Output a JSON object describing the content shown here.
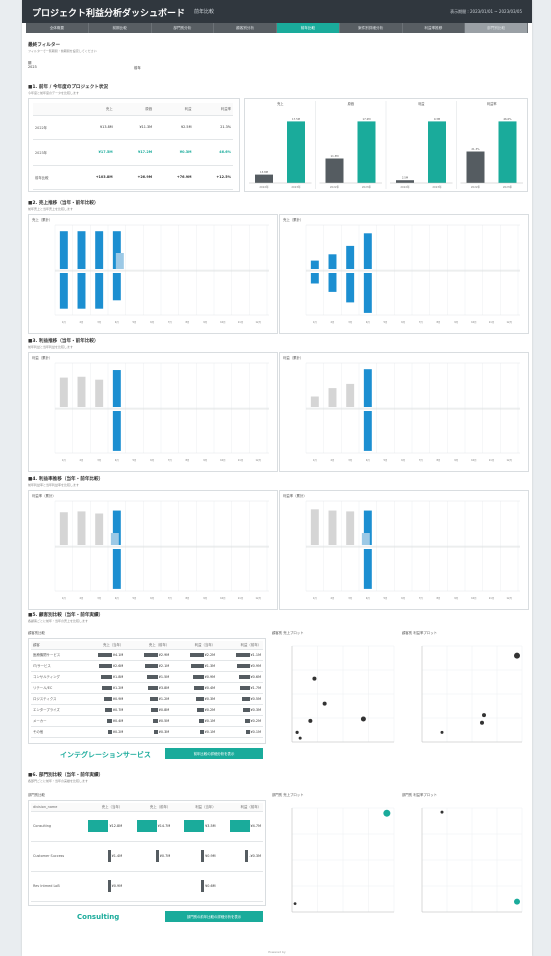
{
  "header": {
    "title": "プロジェクト利益分析ダッシュボード",
    "subtitle": "前年比較",
    "period": "表示期間 : 2023/01/01 ~ 2023/03/05"
  },
  "tabs": [
    "全体概要",
    "前期比較",
    "部門別分析",
    "顧客別分析",
    "前年比較",
    "案件別詳細分析",
    "利益率推移",
    "部門別比較"
  ],
  "active_tab": 4,
  "filter": {
    "title": "最終フィルター",
    "note": "フィルターで一覧期間・前期間を設定してください",
    "a_label": "期",
    "a_value": "2023",
    "b_label": "前年"
  },
  "sec1": {
    "title": "■1. 前年 / 今年度のプロジェクト状況",
    "note": "今年度と前年度のデータを比較します",
    "table": {
      "headers": [
        "",
        "売上",
        "原価",
        "利益",
        "利益率"
      ],
      "rows": [
        [
          "2022年",
          "¥13.8M",
          "¥11.3M",
          "¥2.5M",
          "21.3%"
        ],
        [
          "2023年",
          "¥17.5M",
          "¥17.2M",
          "¥0.3M",
          "46.6%"
        ],
        [
          "前年比較",
          "+103.8M",
          "+26.9M",
          "+76.9M",
          "+12.5%"
        ]
      ]
    },
    "mini_titles": [
      "売上",
      "原価",
      "利益",
      "利益率"
    ],
    "mini_values": [
      [
        "13.8M",
        "17.5M"
      ],
      [
        "11.3M",
        "17.2M"
      ],
      [
        "2.5M",
        "0.3M"
      ],
      [
        "21.3%",
        "46.6%"
      ]
    ],
    "mini_xlabels": [
      "2022年",
      "2023年"
    ]
  },
  "sec2": {
    "title": "■2. 売上推移（当年・前年比較）",
    "note": "前年売上と当年売上を比較します",
    "left_title": "売上（累計）",
    "right_title": "売上（累計）"
  },
  "sec3": {
    "title": "■3. 利益推移（当年・前年比較）",
    "note": "前年利益と当年利益を比較します",
    "left_title": "利益（累計）",
    "right_title": "利益（累計）"
  },
  "sec4": {
    "title": "■4. 利益率推移（当年・前年比較）",
    "note": "前年利益率と当年利益率を比較します",
    "left_title": "利益率（累計）",
    "right_title": "利益率（累計）"
  },
  "sec5": {
    "title": "■5. 顧客別比較（当年・前年実績）",
    "note": "各顧客ごとに前年・当年の売上を比較します",
    "table_title": "顧客別比較",
    "headers": [
      "顧客",
      "売上（当年）",
      "売上（前年）",
      "利益（当年）",
      "利益（前年）"
    ],
    "rows": [
      [
        "医療機関サービス",
        "¥4.1M",
        "¥2.9M",
        "¥2.2M",
        "¥1.1M"
      ],
      [
        "IT/サービス",
        "¥2.6M",
        "¥2.1M",
        "¥1.3M",
        "¥0.9M"
      ],
      [
        "コンサルティング",
        "¥1.8M",
        "¥1.5M",
        "¥0.9M",
        "¥0.6M"
      ],
      [
        "リテール/EC",
        "¥1.2M",
        "¥3.8M",
        "¥0.4M",
        "¥1.7M"
      ],
      [
        "ロジスティクス",
        "¥0.9M",
        "¥1.2M",
        "¥0.3M",
        "¥0.5M"
      ],
      [
        "エンタープライズ",
        "¥0.7M",
        "¥0.8M",
        "¥0.2M",
        "¥0.3M"
      ],
      [
        "メーカー",
        "¥0.4M",
        "¥0.5M",
        "¥0.1M",
        "¥0.2M"
      ],
      [
        "その他",
        "¥0.2M",
        "¥0.3M",
        "¥0.1M",
        "¥0.1M"
      ]
    ],
    "selected": "インテグレーションサービス",
    "button": "前年比較の詳細分析を表示",
    "scatter1_title": "顧客別 売上プロット",
    "scatter2_title": "顧客別 利益率プロット"
  },
  "sec6": {
    "title": "■6. 部門別比較（当年・前年実績）",
    "note": "各部門ごとに前年・当年の実績を比較します",
    "table_title": "部門別比較",
    "headers": [
      "division_name",
      "売上（当年）",
      "売上（前年）",
      "利益（当年）",
      "利益（前年）"
    ],
    "rows": [
      [
        "Consulting",
        "¥12.8M",
        "¥14.7M",
        "¥3.5M",
        "¥4.7M"
      ],
      [
        "Customer Success",
        "¥1.4M",
        "¥0.7M",
        "¥0.9M",
        "-¥0.3M"
      ],
      [
        "Rev Intmed LoB",
        "¥0.9M",
        "",
        "¥0.6M",
        ""
      ]
    ],
    "selected": "Consulting",
    "button": "部門別の前年比較の詳細分析を表示",
    "scatter1_title": "部門別 売上プロット",
    "scatter2_title": "部門別 利益率プロット"
  },
  "footer": "Powered by",
  "colors": {
    "teal": "#1aab9b",
    "blue": "#1c8fd1",
    "gray": "#d5d5d5",
    "dark": "#555c61"
  }
}
